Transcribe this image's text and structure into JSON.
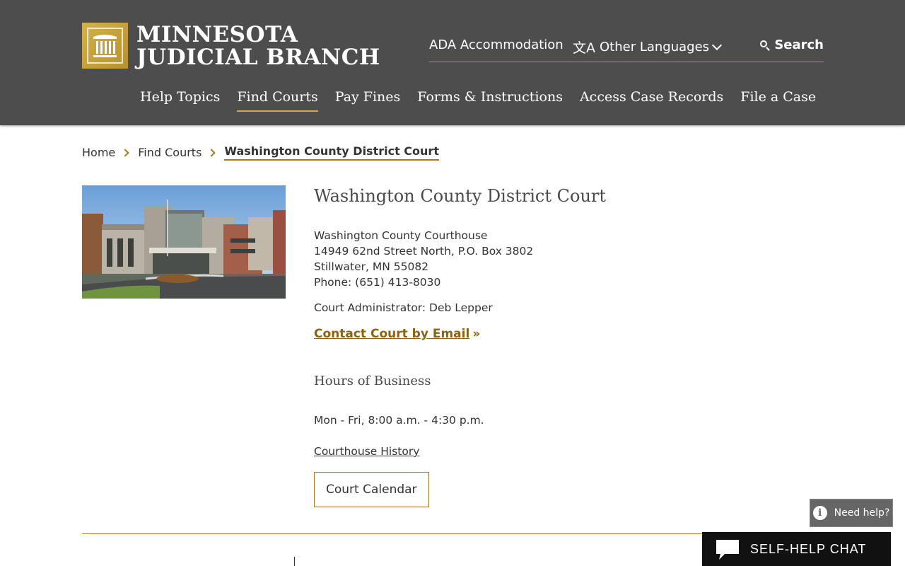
{
  "header": {
    "logo_line1": "MINNESOTA",
    "logo_line2": "JUDICIAL BRANCH",
    "utility": {
      "ada": "ADA Accommodation",
      "languages": "Other Languages",
      "search": "Search"
    },
    "nav": [
      {
        "label": "Help Topics",
        "active": false
      },
      {
        "label": "Find Courts",
        "active": true
      },
      {
        "label": "Pay Fines",
        "active": false
      },
      {
        "label": "Forms & Instructions",
        "active": false
      },
      {
        "label": "Access Case Records",
        "active": false
      },
      {
        "label": "File a Case",
        "active": false
      }
    ]
  },
  "breadcrumb": {
    "items": [
      "Home",
      "Find Courts"
    ],
    "current": "Washington County District Court"
  },
  "court": {
    "title": "Washington County District Court",
    "address_line1": "Washington County Courthouse",
    "address_line2": "14949 62nd Street North, P.O. Box 3802",
    "address_line3": "Stillwater, MN 55082",
    "phone": "Phone: (651) 413-8030",
    "administrator": "Court Administrator: Deb Lepper",
    "email_link": "Contact Court by Email",
    "email_arrow": "»",
    "hours_title": "Hours of Business",
    "hours": "Mon - Fri, 8:00 a.m. - 4:30 p.m.",
    "history_link": "Courthouse History",
    "calendar_button": "Court Calendar"
  },
  "widgets": {
    "need_help": "Need help?",
    "info_glyph": "i",
    "chat": "SELF-HELP CHAT"
  },
  "colors": {
    "header_bg": "#4d4d4d",
    "gold_accent": "#a47a1e",
    "link_gold": "#8a6414"
  }
}
